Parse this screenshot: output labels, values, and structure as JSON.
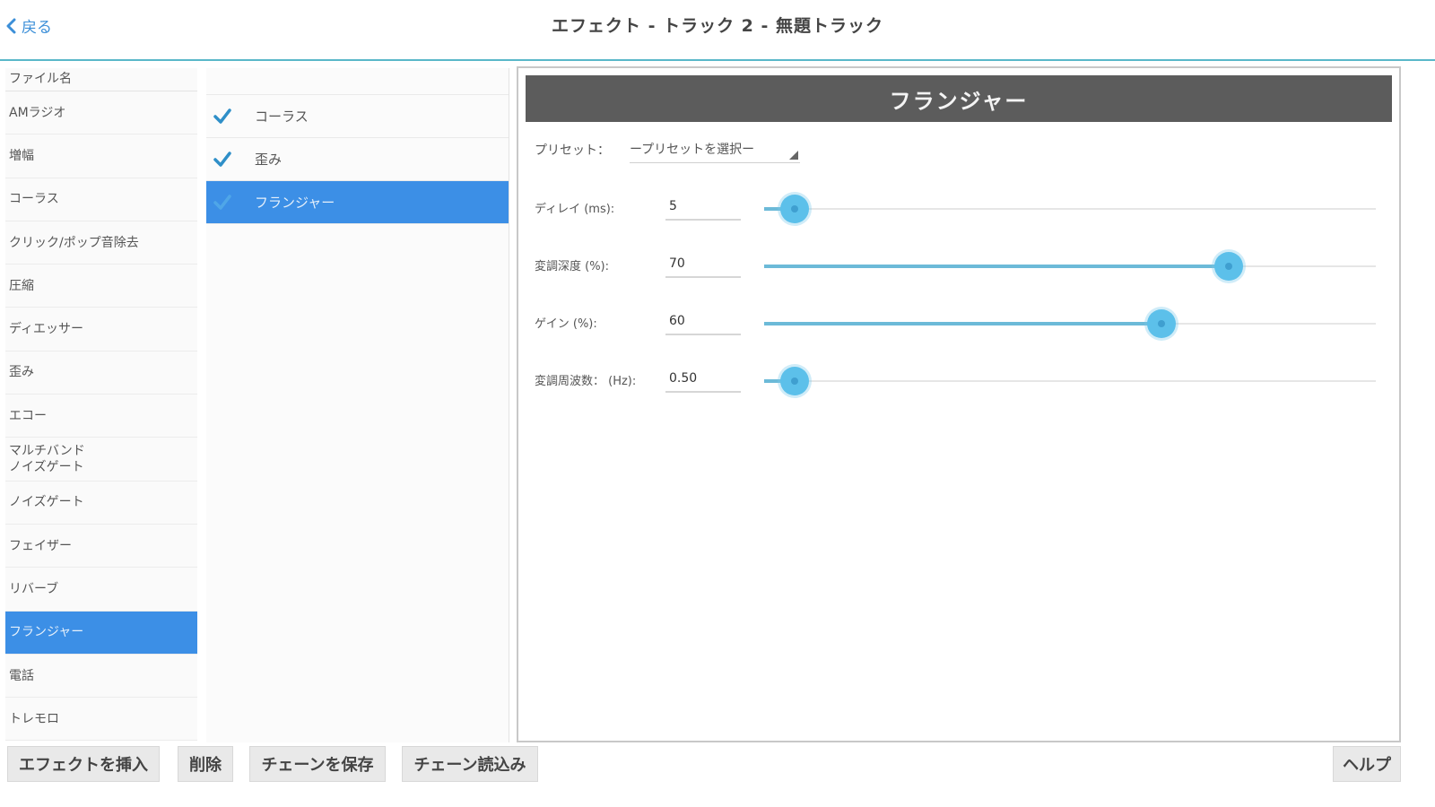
{
  "header": {
    "back_label": "戻る",
    "title": "エフェクト - トラック 2 - 無題トラック"
  },
  "effects_list": {
    "items": [
      "ファイル名",
      "AMラジオ",
      "増幅",
      "コーラス",
      "クリック/ポップ音除去",
      "圧縮",
      "ディエッサー",
      "歪み",
      "エコー",
      "マルチバンド\nノイズゲート",
      "ノイズゲート",
      "フェイザー",
      "リバーブ",
      "フランジャー",
      "電話",
      "トレモロ"
    ],
    "selected": "フランジャー"
  },
  "chain": {
    "items": [
      {
        "label": "コーラス",
        "checked": true
      },
      {
        "label": "歪み",
        "checked": true
      },
      {
        "label": "フランジャー",
        "checked": true
      }
    ],
    "selected": "フランジャー"
  },
  "panel": {
    "title": "フランジャー",
    "preset": {
      "label": "プリセット：",
      "value": "ープリセットを選択ー"
    },
    "params": [
      {
        "label": "ディレイ (ms):",
        "value": "5",
        "level": 0.05
      },
      {
        "label": "変調深度 (%):",
        "value": "70",
        "level": 0.76
      },
      {
        "label": "ゲイン (%):",
        "value": "60",
        "level": 0.65
      },
      {
        "label": "変調周波数： (Hz):",
        "value": "0.50",
        "level": 0.05
      }
    ]
  },
  "toolbar": {
    "insert_label": "エフェクトを挿入",
    "delete_label": "削除",
    "save_chain_label": "チェーンを保存",
    "load_chain_label": "チェーン読込み",
    "help_label": "ヘルプ"
  },
  "colors": {
    "accent": "#3c8fe6",
    "slider": "#5cc0ea",
    "header_rule": "#5ab8c9",
    "panel_title_bg": "#5c5c5c"
  }
}
